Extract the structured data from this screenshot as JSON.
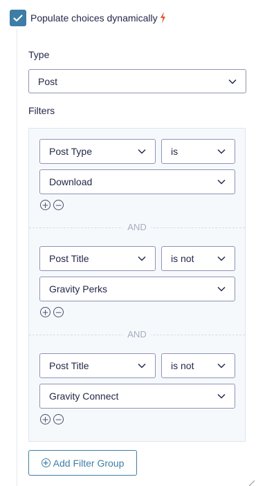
{
  "populate": {
    "label": "Populate choices dynamically",
    "checked": true,
    "icon": "lightning-bolt-icon"
  },
  "type": {
    "label": "Type",
    "value": "Post"
  },
  "filters": {
    "label": "Filters",
    "and_label": "AND",
    "groups": [
      {
        "field": "Post Type",
        "operator": "is",
        "value": "Download"
      },
      {
        "field": "Post Title",
        "operator": "is not",
        "value": "Gravity Perks"
      },
      {
        "field": "Post Title",
        "operator": "is not",
        "value": "Gravity Connect"
      }
    ],
    "add_symbol": "+",
    "remove_symbol": "−"
  },
  "add_group": {
    "icon_symbol": "+",
    "label": "Add Filter Group"
  },
  "colors": {
    "accent": "#3e7da6",
    "text": "#242748",
    "bolt": "#e0592a",
    "border": "#9092b2",
    "filters_bg": "#f6f9fc"
  }
}
